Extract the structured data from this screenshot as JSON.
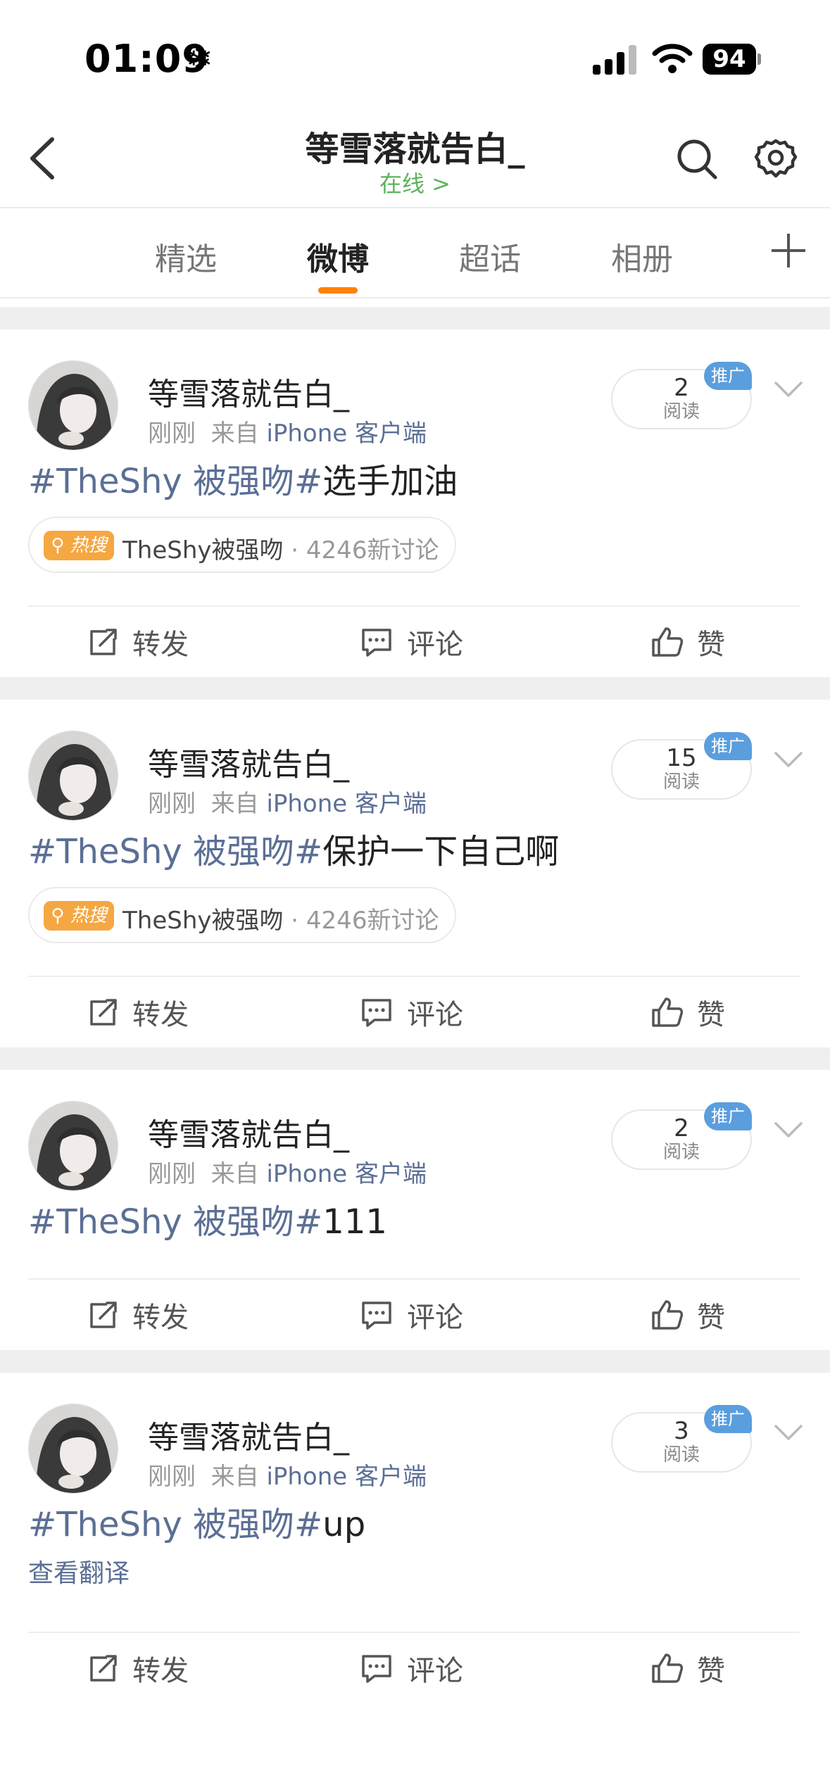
{
  "status_bar": {
    "time": "01:09",
    "focus_icon": "snowflake-icon",
    "battery": "94"
  },
  "nav": {
    "title": "等雪落就告白_",
    "subtitle": "在线 >"
  },
  "tabs": [
    {
      "label": "精选"
    },
    {
      "label": "微博"
    },
    {
      "label": "超话"
    },
    {
      "label": "相册"
    }
  ],
  "active_tab": "微博",
  "accent_color": "#ff8200",
  "link_color": "#5b6f95",
  "online_color": "#5bb35b",
  "posts": [
    {
      "author": "等雪落就告白_",
      "time": "刚刚",
      "source_prefix": "来自",
      "source": "iPhone 客户端",
      "read_count": "2",
      "read_label": "阅读",
      "promo": "推广",
      "hashtag": "#TheShy 被强吻#",
      "text": "选手加油",
      "hot_badge": "热搜",
      "hot_topic": "TheShy被强吻",
      "hot_count": " · 4246新讨论",
      "actions": {
        "repost": "转发",
        "comment": "评论",
        "like": "赞"
      }
    },
    {
      "author": "等雪落就告白_",
      "time": "刚刚",
      "source_prefix": "来自",
      "source": "iPhone 客户端",
      "read_count": "15",
      "read_label": "阅读",
      "promo": "推广",
      "hashtag": "#TheShy 被强吻#",
      "text": "保护一下自己啊",
      "hot_badge": "热搜",
      "hot_topic": "TheShy被强吻",
      "hot_count": " · 4246新讨论",
      "actions": {
        "repost": "转发",
        "comment": "评论",
        "like": "赞"
      }
    },
    {
      "author": "等雪落就告白_",
      "time": "刚刚",
      "source_prefix": "来自",
      "source": "iPhone 客户端",
      "read_count": "2",
      "read_label": "阅读",
      "promo": "推广",
      "hashtag": "#TheShy 被强吻#",
      "text": "111",
      "actions": {
        "repost": "转发",
        "comment": "评论",
        "like": "赞"
      }
    },
    {
      "author": "等雪落就告白_",
      "time": "刚刚",
      "source_prefix": "来自",
      "source": "iPhone 客户端",
      "read_count": "3",
      "read_label": "阅读",
      "promo": "推广",
      "hashtag": "#TheShy 被强吻#",
      "text": "up",
      "translate": "查看翻译",
      "actions": {
        "repost": "转发",
        "comment": "评论",
        "like": "赞"
      }
    }
  ]
}
